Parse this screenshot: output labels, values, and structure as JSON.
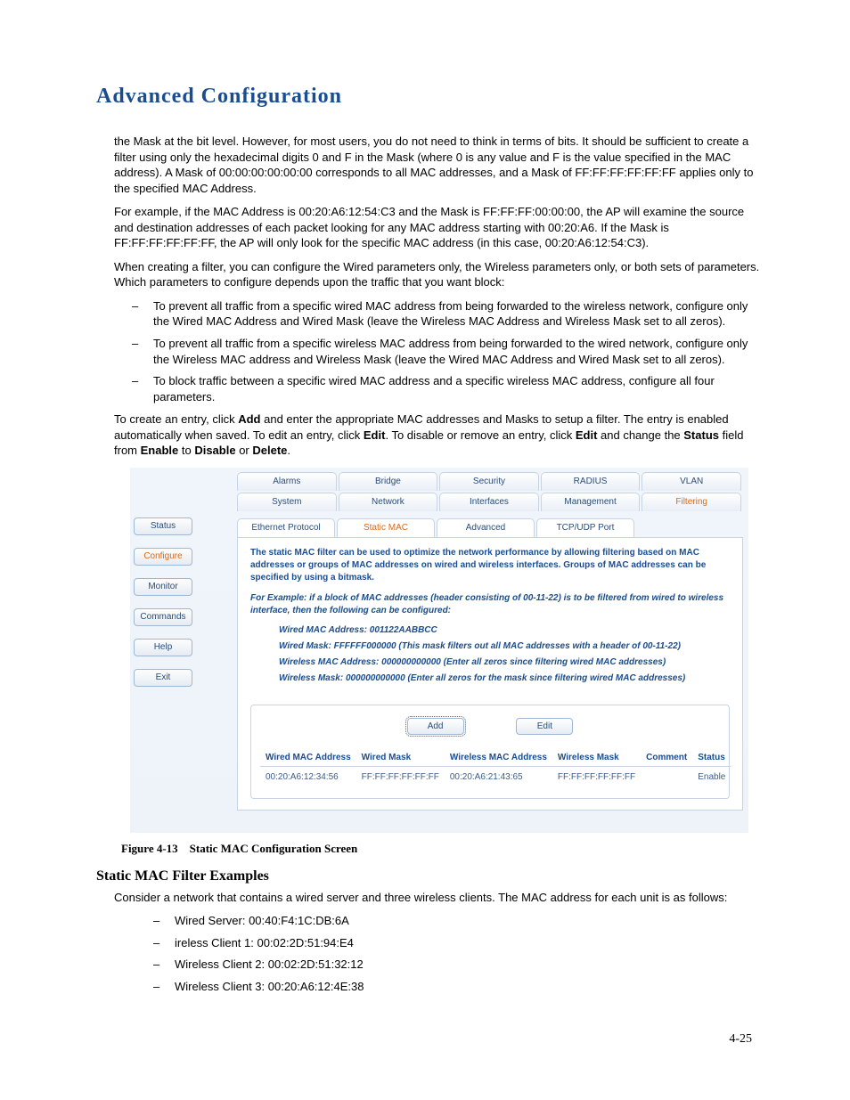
{
  "header": {
    "title": "Advanced Configuration"
  },
  "body": {
    "p1": "the Mask at the bit level. However, for most users, you do not need to think in terms of bits. It should be sufficient to create a filter using only the hexadecimal digits 0 and F in the Mask (where 0 is any value and F is the value specified in the MAC address). A Mask of 00:00:00:00:00:00 corresponds to all MAC addresses, and a Mask of FF:FF:FF:FF:FF:FF applies only to the specified MAC Address.",
    "p2": "For example, if the MAC Address is 00:20:A6:12:54:C3 and the Mask is FF:FF:FF:00:00:00, the AP will examine the source and destination addresses of each packet looking for any MAC address starting with 00:20:A6. If the Mask is FF:FF:FF:FF:FF:FF, the AP will only look for the specific MAC address (in this case, 00:20:A6:12:54:C3).",
    "p3": "When creating a filter, you can configure the Wired parameters only, the Wireless parameters only, or both sets of parameters. Which parameters to configure depends upon the traffic that you want block:",
    "li1": "To prevent all traffic from a specific wired MAC address from being forwarded to the wireless network, configure only the Wired MAC Address and Wired Mask (leave the Wireless MAC Address and Wireless Mask set to all zeros).",
    "li2": "To prevent all traffic from a specific wireless MAC address from being forwarded to the wired network, configure only the Wireless MAC address and Wireless Mask (leave the Wired MAC Address and Wired Mask set to all zeros).",
    "li3": "To block traffic between a specific wired MAC address and a specific wireless MAC address, configure all four parameters.",
    "p4a": "To create an entry, click ",
    "p4b": " and enter the appropriate MAC addresses and Masks to setup a filter. The entry is enabled automatically when saved. To edit an entry, click ",
    "p4c": ". To disable or remove an entry, click ",
    "p4d": " and change the ",
    "p4e": " field from ",
    "p4f": " to ",
    "p4g": " or ",
    "p4h": ".",
    "bold": {
      "add": "Add",
      "edit1": "Edit",
      "edit2": "Edit",
      "status": "Status",
      "enable": "Enable",
      "disable": "Disable",
      "delete": "Delete"
    }
  },
  "ui": {
    "nav": [
      "Status",
      "Configure",
      "Monitor",
      "Commands",
      "Help",
      "Exit"
    ],
    "nav_active_index": 1,
    "tabs_row1": [
      "Alarms",
      "Bridge",
      "Security",
      "RADIUS",
      "VLAN"
    ],
    "tabs_row2": [
      "System",
      "Network",
      "Interfaces",
      "Management",
      "Filtering"
    ],
    "tabs_row2_active_index": 4,
    "subtabs": [
      "Ethernet Protocol",
      "Static MAC",
      "Advanced",
      "TCP/UDP Port"
    ],
    "subtabs_active_index": 1,
    "desc": "The static MAC filter can be used to optimize the network performance by allowing filtering based on MAC addresses or groups of MAC addresses on wired and wireless interfaces. Groups of MAC addresses can be specified by using a bitmask.",
    "example_intro": "For Example: if a block of MAC addresses (header consisting of 00-11-22) is to be filtered from wired to wireless interface, then the following can be configured:",
    "code": {
      "l1": "Wired MAC Address: 001122AABBCC",
      "l2": "Wired Mask: FFFFFF000000 (This mask filters out all MAC addresses with a header of 00-11-22)",
      "l3": "Wireless MAC Address: 000000000000 (Enter all zeros since filtering wired MAC addresses)",
      "l4": "Wireless Mask: 000000000000 (Enter all zeros for the mask since filtering wired MAC addresses)"
    },
    "buttons": {
      "add": "Add",
      "edit": "Edit"
    },
    "table": {
      "headers": [
        "Wired MAC Address",
        "Wired Mask",
        "Wireless MAC Address",
        "Wireless Mask",
        "Comment",
        "Status"
      ],
      "row": [
        "00:20:A6:12:34:56",
        "FF:FF:FF:FF:FF:FF",
        "00:20:A6:21:43:65",
        "FF:FF:FF:FF:FF:FF",
        "",
        "Enable"
      ]
    }
  },
  "caption": "Figure 4-13 Static MAC Configuration Screen",
  "subhead": "Static MAC Filter Examples",
  "after": {
    "p": "Consider a network that contains a wired server and three wireless clients. The MAC address for each unit is as follows:",
    "li1": "Wired Server: 00:40:F4:1C:DB:6A",
    "li2": "ireless Client 1: 00:02:2D:51:94:E4",
    "li3": "Wireless Client 2: 00:02:2D:51:32:12",
    "li4": "Wireless Client 3: 00:20:A6:12:4E:38"
  },
  "pagenum": "4-25"
}
